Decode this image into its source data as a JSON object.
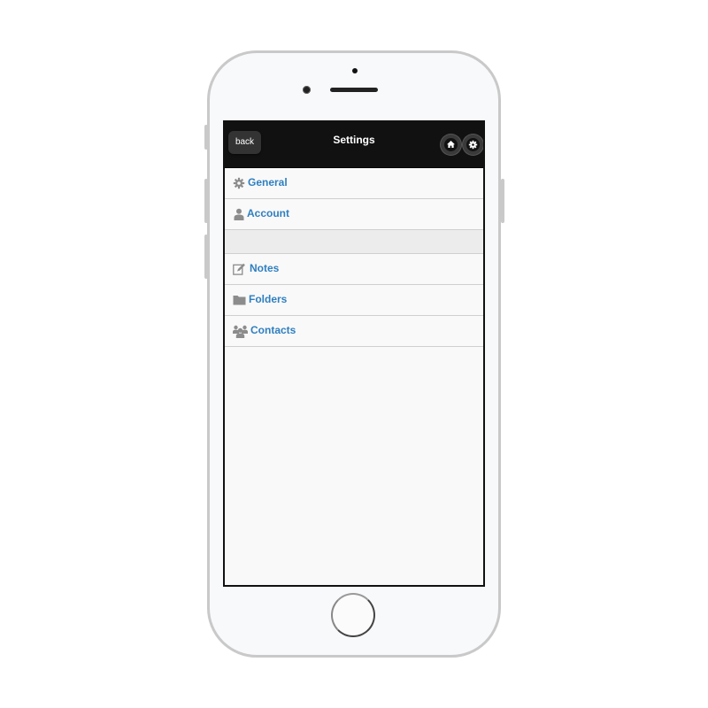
{
  "header": {
    "back_label": "back",
    "title": "Settings",
    "home_icon": "home-icon",
    "settings_icon": "gear-icon"
  },
  "menu": {
    "group1": [
      {
        "label": "General",
        "icon": "gear-icon"
      },
      {
        "label": "Account",
        "icon": "user-icon"
      }
    ],
    "group2": [
      {
        "label": "Notes",
        "icon": "edit-icon"
      },
      {
        "label": "Folders",
        "icon": "folder-icon"
      },
      {
        "label": "Contacts",
        "icon": "users-icon"
      }
    ]
  },
  "colors": {
    "header_bg": "#111111",
    "link": "#2f7fc0",
    "icon_gray": "#8c8c8c"
  }
}
